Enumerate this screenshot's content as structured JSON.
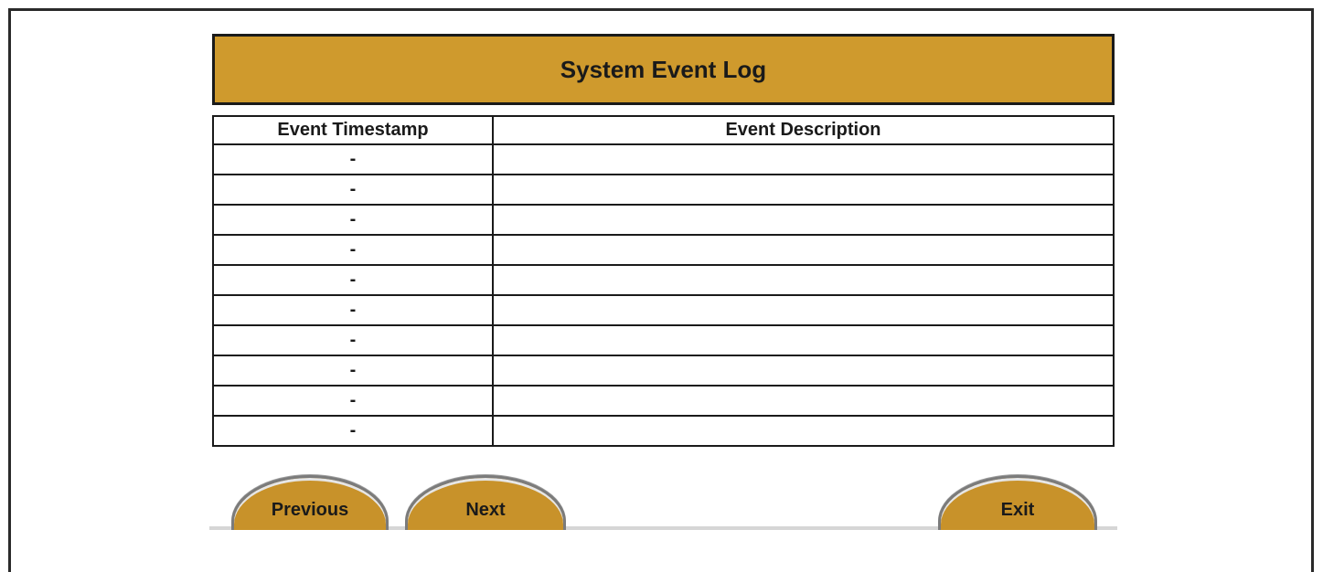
{
  "window": {
    "title": "System Event Log"
  },
  "table": {
    "headers": [
      "Event Timestamp",
      "Event Description"
    ],
    "rows": [
      [
        "-",
        ""
      ],
      [
        "-",
        ""
      ],
      [
        "-",
        ""
      ],
      [
        "-",
        ""
      ],
      [
        "-",
        ""
      ],
      [
        "-",
        ""
      ],
      [
        "-",
        ""
      ],
      [
        "-",
        ""
      ],
      [
        "-",
        ""
      ],
      [
        "-",
        ""
      ]
    ]
  },
  "buttons": {
    "previous": "Previous",
    "next": "Next",
    "exit": "Exit"
  },
  "colors": {
    "accent": "#cf9a2d",
    "button": "#c8922a",
    "border": "#1a1a1a"
  }
}
